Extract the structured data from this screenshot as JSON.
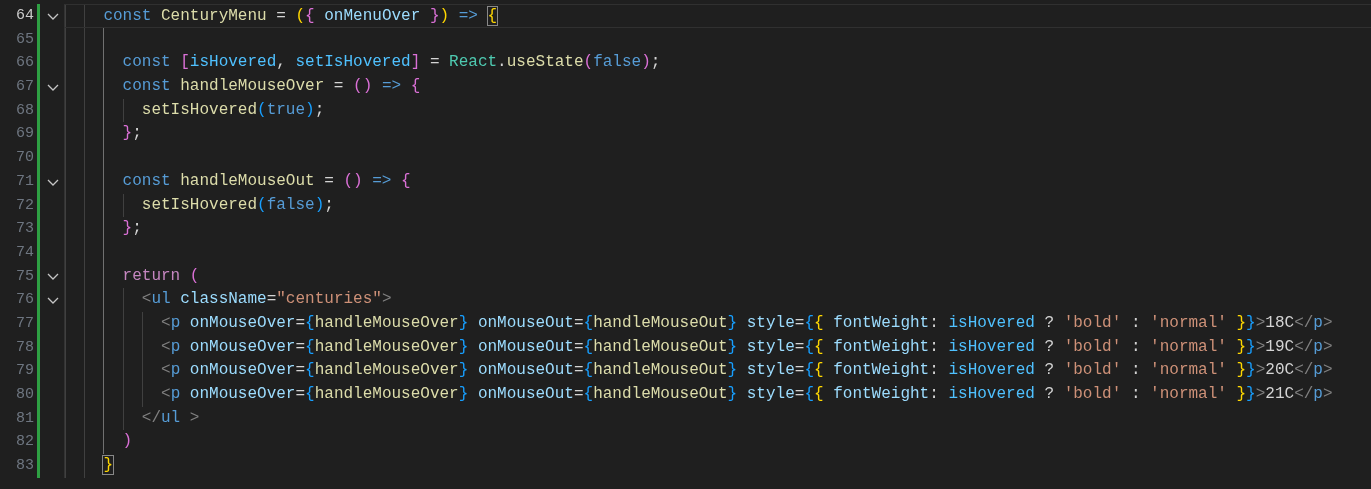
{
  "editor": {
    "lines": [
      {
        "number": "64",
        "current": true,
        "modified": true,
        "expanded": true,
        "tokens": [
          {
            "kind": "kw",
            "text": "    const "
          },
          {
            "kind": "fn",
            "text": "CenturyMenu"
          },
          {
            "kind": "p",
            "text": " = "
          },
          {
            "kind": "b1",
            "text": "("
          },
          {
            "kind": "b2",
            "text": "{ "
          },
          {
            "kind": "var",
            "text": "onMenuOver "
          },
          {
            "kind": "b2",
            "text": "}"
          },
          {
            "kind": "b1",
            "text": ") "
          },
          {
            "kind": "kw",
            "text": "=> "
          },
          {
            "kind": "b1",
            "text": "{",
            "match": true
          }
        ]
      },
      {
        "number": "65",
        "current": false,
        "modified": true
      },
      {
        "number": "66",
        "current": false,
        "modified": true,
        "tokens": [
          {
            "kind": "kw",
            "text": "      const "
          },
          {
            "kind": "b2",
            "text": "["
          },
          {
            "kind": "const",
            "text": "isHovered"
          },
          {
            "kind": "p",
            "text": ", "
          },
          {
            "kind": "const",
            "text": "setIsHovered"
          },
          {
            "kind": "b2",
            "text": "]"
          },
          {
            "kind": "p",
            "text": " = "
          },
          {
            "kind": "cls",
            "text": "React"
          },
          {
            "kind": "p",
            "text": "."
          },
          {
            "kind": "fn",
            "text": "useState"
          },
          {
            "kind": "b2",
            "text": "("
          },
          {
            "kind": "kw",
            "text": "false"
          },
          {
            "kind": "b2",
            "text": ")"
          },
          {
            "kind": "p",
            "text": ";"
          }
        ]
      },
      {
        "number": "67",
        "current": false,
        "modified": true,
        "expanded": true,
        "tokens": [
          {
            "kind": "kw",
            "text": "      const "
          },
          {
            "kind": "fn",
            "text": "handleMouseOver"
          },
          {
            "kind": "p",
            "text": " = "
          },
          {
            "kind": "b2",
            "text": "() "
          },
          {
            "kind": "kw",
            "text": "=> "
          },
          {
            "kind": "b2",
            "text": "{"
          }
        ]
      },
      {
        "number": "68",
        "current": false,
        "modified": true,
        "tokens": [
          {
            "kind": "fn",
            "text": "        setIsHovered"
          },
          {
            "kind": "b3",
            "text": "("
          },
          {
            "kind": "kw",
            "text": "true"
          },
          {
            "kind": "b3",
            "text": ")"
          },
          {
            "kind": "p",
            "text": ";"
          }
        ]
      },
      {
        "number": "69",
        "current": false,
        "modified": true,
        "tokens": [
          {
            "kind": "b2",
            "text": "      }"
          },
          {
            "kind": "p",
            "text": ";"
          }
        ]
      },
      {
        "number": "70",
        "current": false,
        "modified": true
      },
      {
        "number": "71",
        "current": false,
        "modified": true,
        "expanded": true,
        "tokens": [
          {
            "kind": "kw",
            "text": "      const "
          },
          {
            "kind": "fn",
            "text": "handleMouseOut"
          },
          {
            "kind": "p",
            "text": " = "
          },
          {
            "kind": "b2",
            "text": "() "
          },
          {
            "kind": "kw",
            "text": "=> "
          },
          {
            "kind": "b2",
            "text": "{"
          }
        ]
      },
      {
        "number": "72",
        "current": false,
        "modified": true,
        "tokens": [
          {
            "kind": "fn",
            "text": "        setIsHovered"
          },
          {
            "kind": "b3",
            "text": "("
          },
          {
            "kind": "kw",
            "text": "false"
          },
          {
            "kind": "b3",
            "text": ")"
          },
          {
            "kind": "p",
            "text": ";"
          }
        ]
      },
      {
        "number": "73",
        "current": false,
        "modified": true,
        "tokens": [
          {
            "kind": "b2",
            "text": "      }"
          },
          {
            "kind": "p",
            "text": ";"
          }
        ]
      },
      {
        "number": "74",
        "current": false,
        "modified": true
      },
      {
        "number": "75",
        "current": false,
        "modified": true,
        "expanded": true,
        "tokens": [
          {
            "kind": "ctl",
            "text": "      return "
          },
          {
            "kind": "b2",
            "text": "("
          }
        ]
      },
      {
        "number": "76",
        "current": false,
        "modified": true,
        "expanded": true,
        "tokens": [
          {
            "kind": "tagp",
            "text": "        <"
          },
          {
            "kind": "tag",
            "text": "ul "
          },
          {
            "kind": "var",
            "text": "className"
          },
          {
            "kind": "p",
            "text": "="
          },
          {
            "kind": "str",
            "text": "\"centuries\""
          },
          {
            "kind": "tagp",
            "text": ">"
          }
        ]
      },
      {
        "number": "77",
        "current": false,
        "modified": true,
        "tokens": [
          {
            "kind": "tagp",
            "text": "          <"
          },
          {
            "kind": "tag",
            "text": "p "
          },
          {
            "kind": "var",
            "text": "onMouseOver"
          },
          {
            "kind": "p",
            "text": "="
          },
          {
            "kind": "b3",
            "text": "{"
          },
          {
            "kind": "fn",
            "text": "handleMouseOver"
          },
          {
            "kind": "b3",
            "text": "} "
          },
          {
            "kind": "var",
            "text": "onMouseOut"
          },
          {
            "kind": "p",
            "text": "="
          },
          {
            "kind": "b3",
            "text": "{"
          },
          {
            "kind": "fn",
            "text": "handleMouseOut"
          },
          {
            "kind": "b3",
            "text": "} "
          },
          {
            "kind": "var",
            "text": "style"
          },
          {
            "kind": "p",
            "text": "="
          },
          {
            "kind": "b3",
            "text": "{"
          },
          {
            "kind": "b1",
            "text": "{ "
          },
          {
            "kind": "var",
            "text": "fontWeight"
          },
          {
            "kind": "p",
            "text": ": "
          },
          {
            "kind": "const",
            "text": "isHovered"
          },
          {
            "kind": "p",
            "text": " ? "
          },
          {
            "kind": "str",
            "text": "'bold'"
          },
          {
            "kind": "p",
            "text": " : "
          },
          {
            "kind": "str",
            "text": "'normal' "
          },
          {
            "kind": "b1",
            "text": "}"
          },
          {
            "kind": "b3",
            "text": "}"
          },
          {
            "kind": "tagp",
            "text": ">"
          },
          {
            "kind": "p",
            "text": "18C"
          },
          {
            "kind": "tagp",
            "text": "</"
          },
          {
            "kind": "tag",
            "text": "p"
          },
          {
            "kind": "tagp",
            "text": ">"
          }
        ]
      },
      {
        "number": "78",
        "current": false,
        "modified": true,
        "tokens": [
          {
            "kind": "tagp",
            "text": "          <"
          },
          {
            "kind": "tag",
            "text": "p "
          },
          {
            "kind": "var",
            "text": "onMouseOver"
          },
          {
            "kind": "p",
            "text": "="
          },
          {
            "kind": "b3",
            "text": "{"
          },
          {
            "kind": "fn",
            "text": "handleMouseOver"
          },
          {
            "kind": "b3",
            "text": "} "
          },
          {
            "kind": "var",
            "text": "onMouseOut"
          },
          {
            "kind": "p",
            "text": "="
          },
          {
            "kind": "b3",
            "text": "{"
          },
          {
            "kind": "fn",
            "text": "handleMouseOut"
          },
          {
            "kind": "b3",
            "text": "} "
          },
          {
            "kind": "var",
            "text": "style"
          },
          {
            "kind": "p",
            "text": "="
          },
          {
            "kind": "b3",
            "text": "{"
          },
          {
            "kind": "b1",
            "text": "{ "
          },
          {
            "kind": "var",
            "text": "fontWeight"
          },
          {
            "kind": "p",
            "text": ": "
          },
          {
            "kind": "const",
            "text": "isHovered"
          },
          {
            "kind": "p",
            "text": " ? "
          },
          {
            "kind": "str",
            "text": "'bold'"
          },
          {
            "kind": "p",
            "text": " : "
          },
          {
            "kind": "str",
            "text": "'normal' "
          },
          {
            "kind": "b1",
            "text": "}"
          },
          {
            "kind": "b3",
            "text": "}"
          },
          {
            "kind": "tagp",
            "text": ">"
          },
          {
            "kind": "p",
            "text": "19C"
          },
          {
            "kind": "tagp",
            "text": "</"
          },
          {
            "kind": "tag",
            "text": "p"
          },
          {
            "kind": "tagp",
            "text": ">"
          }
        ]
      },
      {
        "number": "79",
        "current": false,
        "modified": true,
        "tokens": [
          {
            "kind": "tagp",
            "text": "          <"
          },
          {
            "kind": "tag",
            "text": "p "
          },
          {
            "kind": "var",
            "text": "onMouseOver"
          },
          {
            "kind": "p",
            "text": "="
          },
          {
            "kind": "b3",
            "text": "{"
          },
          {
            "kind": "fn",
            "text": "handleMouseOver"
          },
          {
            "kind": "b3",
            "text": "} "
          },
          {
            "kind": "var",
            "text": "onMouseOut"
          },
          {
            "kind": "p",
            "text": "="
          },
          {
            "kind": "b3",
            "text": "{"
          },
          {
            "kind": "fn",
            "text": "handleMouseOut"
          },
          {
            "kind": "b3",
            "text": "} "
          },
          {
            "kind": "var",
            "text": "style"
          },
          {
            "kind": "p",
            "text": "="
          },
          {
            "kind": "b3",
            "text": "{"
          },
          {
            "kind": "b1",
            "text": "{ "
          },
          {
            "kind": "var",
            "text": "fontWeight"
          },
          {
            "kind": "p",
            "text": ": "
          },
          {
            "kind": "const",
            "text": "isHovered"
          },
          {
            "kind": "p",
            "text": " ? "
          },
          {
            "kind": "str",
            "text": "'bold'"
          },
          {
            "kind": "p",
            "text": " : "
          },
          {
            "kind": "str",
            "text": "'normal' "
          },
          {
            "kind": "b1",
            "text": "}"
          },
          {
            "kind": "b3",
            "text": "}"
          },
          {
            "kind": "tagp",
            "text": ">"
          },
          {
            "kind": "p",
            "text": "20C"
          },
          {
            "kind": "tagp",
            "text": "</"
          },
          {
            "kind": "tag",
            "text": "p"
          },
          {
            "kind": "tagp",
            "text": ">"
          }
        ]
      },
      {
        "number": "80",
        "current": false,
        "modified": true,
        "tokens": [
          {
            "kind": "tagp",
            "text": "          <"
          },
          {
            "kind": "tag",
            "text": "p "
          },
          {
            "kind": "var",
            "text": "onMouseOver"
          },
          {
            "kind": "p",
            "text": "="
          },
          {
            "kind": "b3",
            "text": "{"
          },
          {
            "kind": "fn",
            "text": "handleMouseOver"
          },
          {
            "kind": "b3",
            "text": "} "
          },
          {
            "kind": "var",
            "text": "onMouseOut"
          },
          {
            "kind": "p",
            "text": "="
          },
          {
            "kind": "b3",
            "text": "{"
          },
          {
            "kind": "fn",
            "text": "handleMouseOut"
          },
          {
            "kind": "b3",
            "text": "} "
          },
          {
            "kind": "var",
            "text": "style"
          },
          {
            "kind": "p",
            "text": "="
          },
          {
            "kind": "b3",
            "text": "{"
          },
          {
            "kind": "b1",
            "text": "{ "
          },
          {
            "kind": "var",
            "text": "fontWeight"
          },
          {
            "kind": "p",
            "text": ": "
          },
          {
            "kind": "const",
            "text": "isHovered"
          },
          {
            "kind": "p",
            "text": " ? "
          },
          {
            "kind": "str",
            "text": "'bold'"
          },
          {
            "kind": "p",
            "text": " : "
          },
          {
            "kind": "str",
            "text": "'normal' "
          },
          {
            "kind": "b1",
            "text": "}"
          },
          {
            "kind": "b3",
            "text": "}"
          },
          {
            "kind": "tagp",
            "text": ">"
          },
          {
            "kind": "p",
            "text": "21C"
          },
          {
            "kind": "tagp",
            "text": "</"
          },
          {
            "kind": "tag",
            "text": "p"
          },
          {
            "kind": "tagp",
            "text": ">"
          }
        ]
      },
      {
        "number": "81",
        "current": false,
        "modified": true,
        "tokens": [
          {
            "kind": "tagp",
            "text": "        </"
          },
          {
            "kind": "tag",
            "text": "ul "
          },
          {
            "kind": "tagp",
            "text": ">"
          }
        ]
      },
      {
        "number": "82",
        "current": false,
        "modified": true,
        "tokens": [
          {
            "kind": "b2",
            "text": "      )"
          }
        ]
      },
      {
        "number": "83",
        "current": false,
        "modified": true,
        "tokens": [
          {
            "kind": "b1",
            "text": "    }",
            "match": true
          }
        ]
      }
    ]
  }
}
